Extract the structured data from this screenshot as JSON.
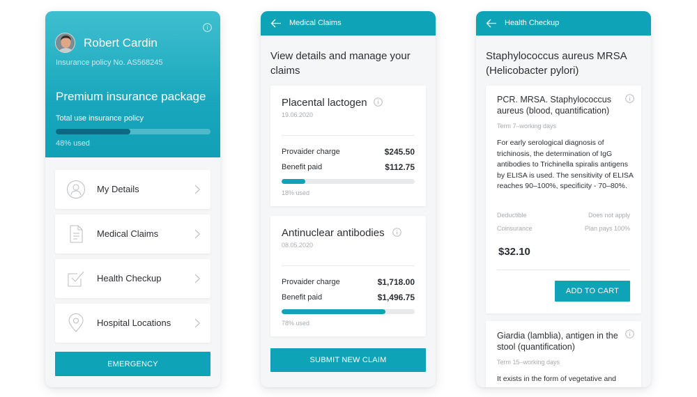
{
  "colors": {
    "accent": "#0fa3b8",
    "progress_dark": "#0a6a84",
    "background": "#f5f6f7"
  },
  "insurance": {
    "user_name": "Robert Cardin",
    "policy_number": "Insurance policy No. AS568245",
    "package_name": "Premium insurance package",
    "usage_label": "Total use insurance policy",
    "usage_fraction": 0.48,
    "usage_text": "48% used",
    "menu": [
      {
        "label": "My Details",
        "icon": "user-icon"
      },
      {
        "label": "Medical Claims",
        "icon": "document-icon"
      },
      {
        "label": "Health Checkup",
        "icon": "checkbox-icon"
      },
      {
        "label": "Hospital Locations",
        "icon": "map-pin-icon"
      }
    ],
    "emergency_label": "EMERGENCY"
  },
  "claims": {
    "title": "Medical Claims",
    "heading": "View details and manage your claims",
    "items": [
      {
        "name": "Placental lactogen",
        "date": "19.06.2020",
        "charge_label": "Provaider charge",
        "charge": "$245.50",
        "paid_label": "Benefit paid",
        "paid": "$112.75",
        "used_fraction": 0.18,
        "used_text": "18% used"
      },
      {
        "name": "Antinuclear antibodies",
        "date": "08.05.2020",
        "charge_label": "Provaider charge",
        "charge": "$1,718.00",
        "paid_label": "Benefit paid",
        "paid": "$1,496.75",
        "used_fraction": 0.78,
        "used_text": "78% used"
      }
    ],
    "submit_label": "SUBMIT NEW CLAIM"
  },
  "checkup": {
    "title": "Health Checkup",
    "heading": "Staphylococcus aureus MRSA (Helicobacter pylori)",
    "tests": [
      {
        "name": "PCR. MRSA. Staphylococcus aureus (blood, quantification)",
        "term": "Term 7–working days",
        "description": "For early serological diagnosis of trichinosis, the determination of IgG antibodies to Trichinella spiralis antigens by ELISA is used. The sensitivity of ELISA reaches 90–100%, specificity - 70–80%.",
        "deductible_label": "Deductible",
        "deductible_value": "Does not apply",
        "coinsurance_label": "Coinsurance",
        "coinsurance_value": "Plan pays 100%",
        "price": "$32.10",
        "cart_label": "ADD TO CART"
      },
      {
        "name": "Giardia (lamblia), antigen in the stool (quantification)",
        "term": "Term 15–working days",
        "description": "It exists in the form of vegetative and"
      }
    ]
  }
}
